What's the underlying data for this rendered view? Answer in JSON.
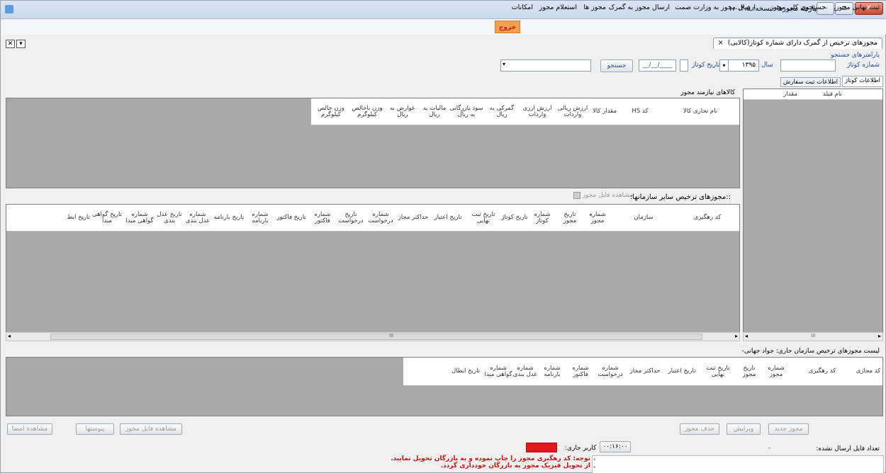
{
  "window": {
    "title": "سامانه یکپارچه مجوزها -نسخه: ۱،۰،۴،۵"
  },
  "menu": {
    "items": [
      "ثبت نهایی مجوز",
      "جستجوی کلی مجوز",
      "ارسال مجوز به وزارت صمت",
      "ارسال مجوز به گمرک",
      "مجوز ها",
      "استعلام مجوز",
      "امکانات"
    ],
    "exit": "خروج"
  },
  "doc_tab": {
    "title": "مجوزهای ترخیص از گمرک دارای شماره کوتاژ(کالایی)",
    "close": "×"
  },
  "search": {
    "params_label": "پارامترهای جستجو",
    "kotaj_number_label": "شماره کوتاژ",
    "year_label": "سال",
    "year_value": "۱۳۹۵",
    "kotaj_date_label": "تاریخ کوتاژ",
    "date_placeholder": "__/__/____",
    "search_button": "جستجو"
  },
  "tabs": [
    "اطلاعات کوتاژ",
    "اطلاعات ثبت سفارش"
  ],
  "left_grid": {
    "columns": [
      "نام فیلد",
      "مقدار"
    ]
  },
  "goods": {
    "title": "کالاهای نیازمند مجوز",
    "columns": [
      "نام تجاری کالا",
      "کد HS",
      "مقدار کالا",
      "ارزش ریالی واردات",
      "ارزش ارزی واردات",
      "گمرکی به ریال",
      "سود بازرگانی به ریال",
      "مالیات به ریال",
      "عوارض به ریال",
      "وزن ناخالص کیلوگرم",
      "وزن خالص کیلوگرم"
    ]
  },
  "orgs": {
    "title": "::مجوزهای ترخیص سایر سازمانها:",
    "view_file": "مشاهده فایل مجوز",
    "columns": [
      "کد رهگیری",
      "سازمان",
      "شماره مجوز",
      "تاریخ مجوز",
      "شماره کوتاژ",
      "تاریخ کوتاژ",
      "تاریخ ثبت نهایی",
      "تاریخ اعتبار",
      "حداکثر مجاز",
      "شماره درخواست",
      "تاریخ درخواست",
      "شماره فاکتور",
      "تاریخ فاکتور",
      "شماره بارنامه",
      "تاریخ بارنامه",
      "شماره عدل بندی",
      "تاریخ عدل بندی",
      "شماره گواهی مبدا",
      "تاریخ گواهی مبدا",
      "تاریخ ابط"
    ]
  },
  "current": {
    "title": "لیست مجوزهای ترخیص سازمان جاری: جواد جهانی-",
    "columns": [
      "کد مجازی",
      "کد رهگیری",
      "شماره مجوز",
      "تاریخ مجوز",
      "تاریخ ثبت نهایی",
      "تاریخ اعتبار",
      "حداکثر مجاز",
      "شماره درخواست",
      "شماره فاکتور",
      "شماره بارنامه",
      "شماره عدل بندی",
      "شماره گواهی مبدا",
      "تاریخ ابطال"
    ]
  },
  "actions_right": [
    "مجوز جدید",
    "ویرایش",
    "حذف مجوز"
  ],
  "actions_left": [
    "مشاهده فایل مجوز",
    "پیوستها",
    "مشاهده امضا"
  ],
  "footer": {
    "unsent_label": "تعداد فایل ارسال نشده:",
    "unsent_value": "-",
    "current_user_label": "کاربر جاری:",
    "time": "۰۰:۱۶:۰۰",
    "warning": "توجه: کد رهگیری مجوز را چاپ نموده و به بازرگان تحویل نمایید. از تحویل فیزیک مجوز به بازرگان خودداری گردد."
  },
  "scroll_mark": "III",
  "colors": {
    "exit_bg": "#f0a050",
    "grid_bg": "#a9a9a9",
    "user_red": "#dd1a1a"
  }
}
